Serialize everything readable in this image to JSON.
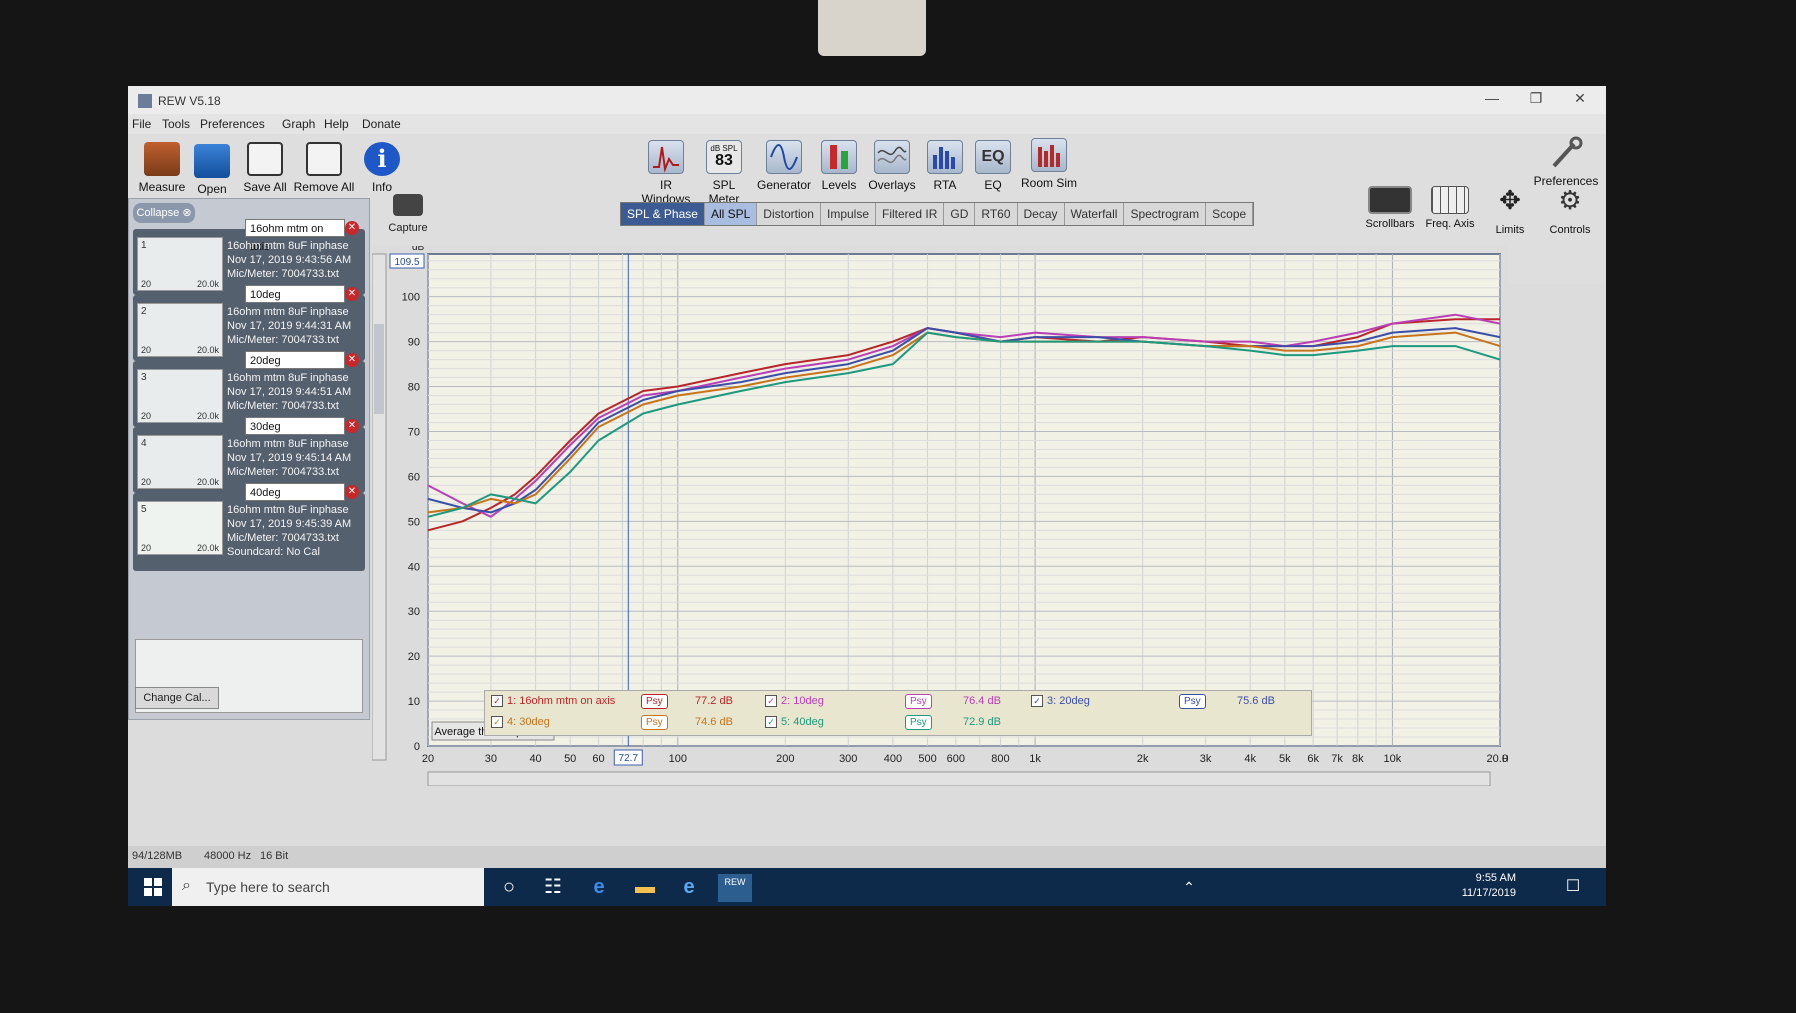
{
  "window": {
    "title": "REW V5.18",
    "controls": [
      "—",
      "❐",
      "✕"
    ]
  },
  "menu": [
    "File",
    "Tools",
    "Preferences",
    "Graph",
    "Help",
    "Donate"
  ],
  "toolbar": {
    "left": [
      "Measure",
      "Open",
      "Save All",
      "Remove All",
      "Info"
    ],
    "center": [
      "IR Windows",
      "SPL Meter",
      "Generator",
      "Levels",
      "Overlays",
      "RTA",
      "EQ",
      "Room Sim"
    ],
    "spl_meter_value": "83",
    "spl_meter_unit": "dB SPL",
    "eq_text": "EQ",
    "info_glyph": "i",
    "preferences": "Preferences"
  },
  "graph_tools": [
    "Scrollbars",
    "Freq. Axis",
    "Limits",
    "Controls"
  ],
  "tabs": [
    "SPL & Phase",
    "All SPL",
    "Distortion",
    "Impulse",
    "Filtered IR",
    "GD",
    "RT60",
    "Decay",
    "Waterfall",
    "Spectrogram",
    "Scope"
  ],
  "left_panel": {
    "collapse_label": "Collapse",
    "change_cal": "Change Cal...",
    "measurements": [
      {
        "num": "1",
        "name": "16ohm mtm on axis",
        "desc": "16ohm mtm 8uF inphase",
        "date": "Nov 17, 2019 9:43:56 AM",
        "mic": "Mic/Meter: 7004733.txt",
        "lo": "20",
        "hi": "20.0k"
      },
      {
        "num": "2",
        "name": "10deg",
        "desc": "16ohm mtm 8uF inphase",
        "date": "Nov 17, 2019 9:44:31 AM",
        "mic": "Mic/Meter: 7004733.txt",
        "lo": "20",
        "hi": "20.0k"
      },
      {
        "num": "3",
        "name": "20deg",
        "desc": "16ohm mtm 8uF inphase",
        "date": "Nov 17, 2019 9:44:51 AM",
        "mic": "Mic/Meter: 7004733.txt",
        "lo": "20",
        "hi": "20.0k"
      },
      {
        "num": "4",
        "name": "30deg",
        "desc": "16ohm mtm 8uF inphase",
        "date": "Nov 17, 2019 9:45:14 AM",
        "mic": "Mic/Meter: 7004733.txt",
        "lo": "20",
        "hi": "20.0k"
      },
      {
        "num": "5",
        "name": "40deg",
        "desc": "16ohm mtm 8uF inphase",
        "date": "Nov 17, 2019 9:45:39 AM",
        "mic": "Mic/Meter: 7004733.txt",
        "soundcard": "Soundcard: No Cal",
        "lo": "20",
        "hi": "20.0k"
      }
    ]
  },
  "capture_label": "Capture",
  "graph": {
    "y_unit": "dB",
    "y_top_value": "109.5",
    "cursor_freq": "72.7",
    "x_unit": "Hz",
    "average_button": "Average the Responses"
  },
  "legend": [
    {
      "label": "1: 16ohm mtm on axis",
      "psy": "Psy",
      "db": "77.2 dB",
      "color": "#b8262a"
    },
    {
      "label": "2: 10deg",
      "psy": "Psy",
      "db": "76.4 dB",
      "color": "#b93fb6"
    },
    {
      "label": "3: 20deg",
      "psy": "Psy",
      "db": "75.6 dB",
      "color": "#3c4fa8"
    },
    {
      "label": "4: 30deg",
      "psy": "Psy",
      "db": "74.6 dB",
      "color": "#c7741a"
    },
    {
      "label": "5: 40deg",
      "psy": "Psy",
      "db": "72.9 dB",
      "color": "#1d9a7d"
    }
  ],
  "status": {
    "memory": "94/128MB",
    "rate": "48000 Hz",
    "bits": "16 Bit"
  },
  "taskbar": {
    "search_placeholder": "Type here to search",
    "rew_icon": "REW",
    "time": "9:55 AM",
    "date": "11/17/2019"
  },
  "chart_data": {
    "type": "line",
    "xlabel": "Hz",
    "ylabel": "dB",
    "x_scale": "log",
    "xlim": [
      20,
      20000
    ],
    "ylim": [
      0,
      109.5
    ],
    "x_ticks": [
      "20",
      "30",
      "40",
      "50",
      "60",
      "100",
      "200",
      "300",
      "400",
      "500",
      "600",
      "800",
      "1k",
      "2k",
      "3k",
      "4k",
      "5k",
      "6k",
      "7k",
      "8k",
      "10k",
      "20.0k"
    ],
    "y_ticks": [
      0,
      10,
      20,
      30,
      40,
      50,
      60,
      70,
      80,
      90,
      100
    ],
    "grid": true,
    "x": [
      20,
      25,
      30,
      35,
      40,
      50,
      60,
      80,
      100,
      150,
      200,
      300,
      400,
      500,
      600,
      800,
      1000,
      1500,
      2000,
      3000,
      4000,
      5000,
      6000,
      8000,
      10000,
      15000,
      20000
    ],
    "series": [
      {
        "name": "1: 16ohm mtm on axis",
        "color": "#b8262a",
        "values": [
          48,
          50,
          53,
          56,
          60,
          68,
          74,
          79,
          80,
          83,
          85,
          87,
          90,
          93,
          92,
          90,
          91,
          90,
          91,
          90,
          89,
          89,
          89,
          91,
          94,
          95,
          95
        ]
      },
      {
        "name": "2: 10deg",
        "color": "#b93fb6",
        "values": [
          58,
          54,
          51,
          55,
          59,
          67,
          73,
          78,
          79,
          82,
          84,
          86,
          89,
          93,
          92,
          91,
          92,
          91,
          91,
          90,
          90,
          89,
          90,
          92,
          94,
          96,
          94
        ]
      },
      {
        "name": "3: 20deg",
        "color": "#3c4fa8",
        "values": [
          55,
          53,
          52,
          54,
          57,
          65,
          72,
          77,
          79,
          81,
          83,
          85,
          88,
          93,
          92,
          90,
          91,
          91,
          90,
          89,
          89,
          89,
          89,
          90,
          92,
          93,
          91
        ]
      },
      {
        "name": "4: 30deg",
        "color": "#c7741a",
        "values": [
          52,
          53,
          55,
          54,
          56,
          64,
          71,
          76,
          78,
          80,
          82,
          84,
          87,
          92,
          91,
          90,
          90,
          90,
          90,
          89,
          89,
          88,
          88,
          89,
          91,
          92,
          89
        ]
      },
      {
        "name": "5: 40deg",
        "color": "#1d9a7d",
        "values": [
          51,
          53,
          56,
          55,
          54,
          61,
          68,
          74,
          76,
          79,
          81,
          83,
          85,
          92,
          91,
          90,
          90,
          90,
          90,
          89,
          88,
          87,
          87,
          88,
          89,
          89,
          86
        ]
      }
    ]
  }
}
